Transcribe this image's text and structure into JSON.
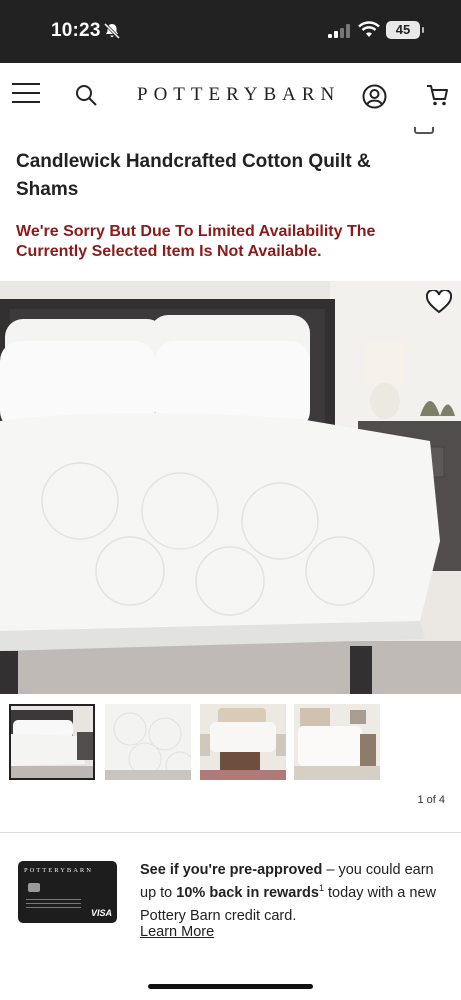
{
  "status_bar": {
    "time": "10:23",
    "battery": "45",
    "icons": [
      "bell-slash-icon",
      "signal-icon",
      "wifi-icon",
      "battery-icon"
    ]
  },
  "nav": {
    "brand": "POTTERYBARN",
    "icons": [
      "menu-icon",
      "search-icon",
      "account-icon",
      "cart-icon"
    ]
  },
  "product": {
    "title": "Candlewick Handcrafted Cotton Quilt & Shams",
    "availability_message": "We're Sorry But Due To Limited Availability The Currently Selected Item Is Not Available.",
    "favorite_icon": "heart-icon"
  },
  "gallery": {
    "counter": "1 of 4",
    "thumbnail_count": 4,
    "active_index": 0
  },
  "promo": {
    "card_brand": "POTTERYBARN",
    "card_network": "VISA",
    "lead": "See if you're pre-approved",
    "middle": " – you could earn up to ",
    "highlight": "10% back in rewards",
    "footnote": "1",
    "tail": " today with a new Pottery Barn credit card.",
    "link": "Learn More"
  },
  "colors": {
    "status_bar_bg": "#222222",
    "alert_text": "#8b1a1a",
    "text": "#222222",
    "divider": "#dddddd"
  }
}
